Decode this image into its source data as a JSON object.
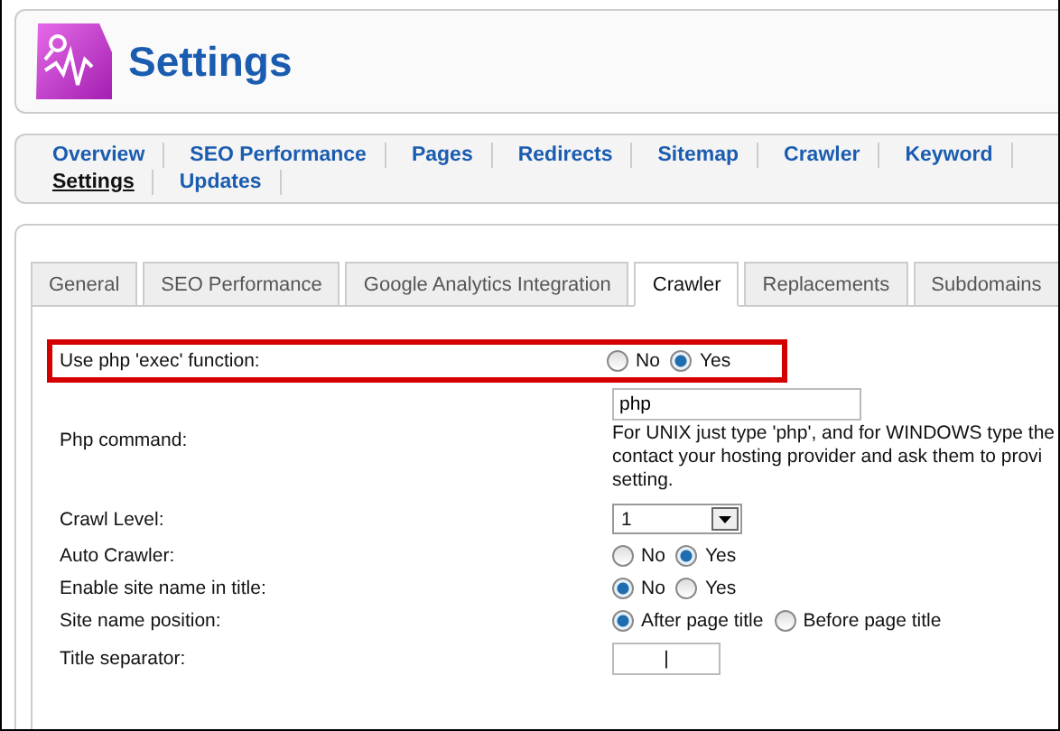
{
  "header": {
    "title": "Settings"
  },
  "nav": {
    "rows": [
      [
        {
          "label": "Overview",
          "selected": false
        },
        {
          "label": "SEO Performance",
          "selected": false
        },
        {
          "label": "Pages",
          "selected": false
        },
        {
          "label": "Redirects",
          "selected": false
        },
        {
          "label": "Sitemap",
          "selected": false
        },
        {
          "label": "Crawler",
          "selected": false
        },
        {
          "label": "Keyword",
          "selected": false
        }
      ],
      [
        {
          "label": "Settings",
          "selected": true
        },
        {
          "label": "Updates",
          "selected": false
        }
      ]
    ]
  },
  "tabs": [
    {
      "label": "General",
      "selected": false
    },
    {
      "label": "SEO Performance",
      "selected": false
    },
    {
      "label": "Google Analytics Integration",
      "selected": false
    },
    {
      "label": "Crawler",
      "selected": true
    },
    {
      "label": "Replacements",
      "selected": false
    },
    {
      "label": "Subdomains",
      "selected": false
    }
  ],
  "fields": [
    {
      "kind": "radio",
      "label": "Use php 'exec' function:",
      "highlighted": true,
      "options": [
        {
          "label": "No",
          "selected": false
        },
        {
          "label": "Yes",
          "selected": true
        }
      ]
    },
    {
      "kind": "text",
      "label": "Php command:",
      "highlighted": false,
      "value": "php",
      "help": [
        "For UNIX just type 'php', and for WINDOWS type the",
        "contact your hosting provider and ask them to provi",
        "setting."
      ]
    },
    {
      "kind": "select",
      "label": "Crawl Level:",
      "highlighted": false,
      "value": "1"
    },
    {
      "kind": "radio",
      "label": "Auto Crawler:",
      "highlighted": false,
      "options": [
        {
          "label": "No",
          "selected": false
        },
        {
          "label": "Yes",
          "selected": true
        }
      ]
    },
    {
      "kind": "radio",
      "label": "Enable site name in title:",
      "highlighted": false,
      "options": [
        {
          "label": "No",
          "selected": true
        },
        {
          "label": "Yes",
          "selected": false
        }
      ]
    },
    {
      "kind": "radio",
      "label": "Site name position:",
      "highlighted": false,
      "options": [
        {
          "label": "After page title",
          "selected": true
        },
        {
          "label": "Before page title",
          "selected": false
        }
      ]
    },
    {
      "kind": "short",
      "label": "Title separator:",
      "highlighted": false,
      "value": "|"
    }
  ]
}
